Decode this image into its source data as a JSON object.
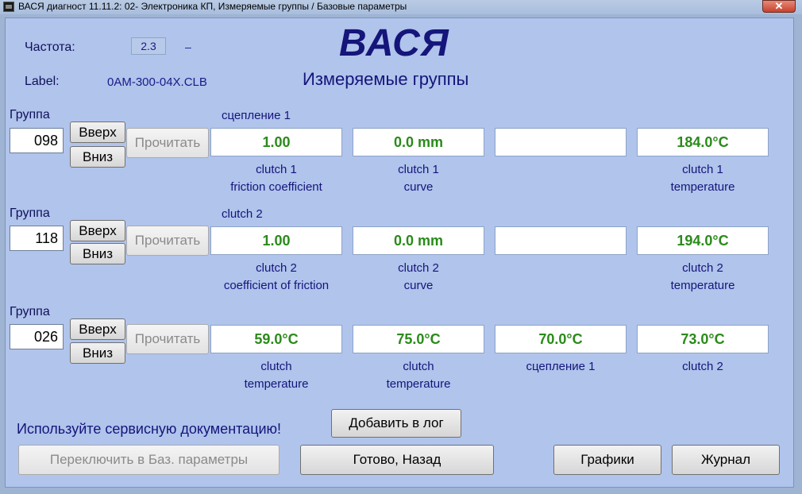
{
  "window": {
    "title": "ВАСЯ диагност 11.11.2: 02- Электроника КП,  Измеряемые группы / Базовые параметры",
    "close_label": "✕"
  },
  "header": {
    "freq_label": "Частота:",
    "freq_value": "2.3",
    "freq_dash": "–",
    "label_label": "Label:",
    "label_value": "0AM-300-04X.CLB",
    "brand": "ВАСЯ",
    "subtitle": "Измеряемые группы"
  },
  "groups": [
    {
      "title": "Группа",
      "number": "098",
      "up": "Вверх",
      "down": "Вниз",
      "read": "Прочитать",
      "name": "сцепление 1",
      "values": [
        "1.00",
        "0.0 mm",
        "",
        "184.0°C"
      ],
      "desc": [
        [
          "clutch 1",
          "friction coefficient"
        ],
        [
          "clutch 1",
          "curve"
        ],
        [
          "",
          ""
        ],
        [
          "clutch 1",
          "temperature"
        ]
      ]
    },
    {
      "title": "Группа",
      "number": "118",
      "up": "Вверх",
      "down": "Вниз",
      "read": "Прочитать",
      "name": "clutch 2",
      "values": [
        "1.00",
        "0.0 mm",
        "",
        "194.0°C"
      ],
      "desc": [
        [
          "clutch 2",
          "coefficient of friction"
        ],
        [
          "clutch 2",
          "curve"
        ],
        [
          "",
          ""
        ],
        [
          "clutch 2",
          "temperature"
        ]
      ]
    },
    {
      "title": "Группа",
      "number": "026",
      "up": "Вверх",
      "down": "Вниз",
      "read": "Прочитать",
      "name": "",
      "values": [
        "59.0°C",
        "75.0°C",
        "70.0°C",
        "73.0°C"
      ],
      "desc": [
        [
          "clutch",
          "temperature"
        ],
        [
          "clutch",
          "temperature"
        ],
        [
          "сцепление 1",
          ""
        ],
        [
          "clutch 2",
          ""
        ]
      ]
    }
  ],
  "footer": {
    "notice": "Используйте сервисную документацию!",
    "add_log": "Добавить в лог",
    "switch_basic": "Переключить в Баз. параметры",
    "done_back": "Готово, Назад",
    "graphs": "Графики",
    "journal": "Журнал"
  },
  "colors": {
    "value_text": "#2a8a1a",
    "label_text": "#15157a",
    "client_bg": "#b0c4ec"
  }
}
